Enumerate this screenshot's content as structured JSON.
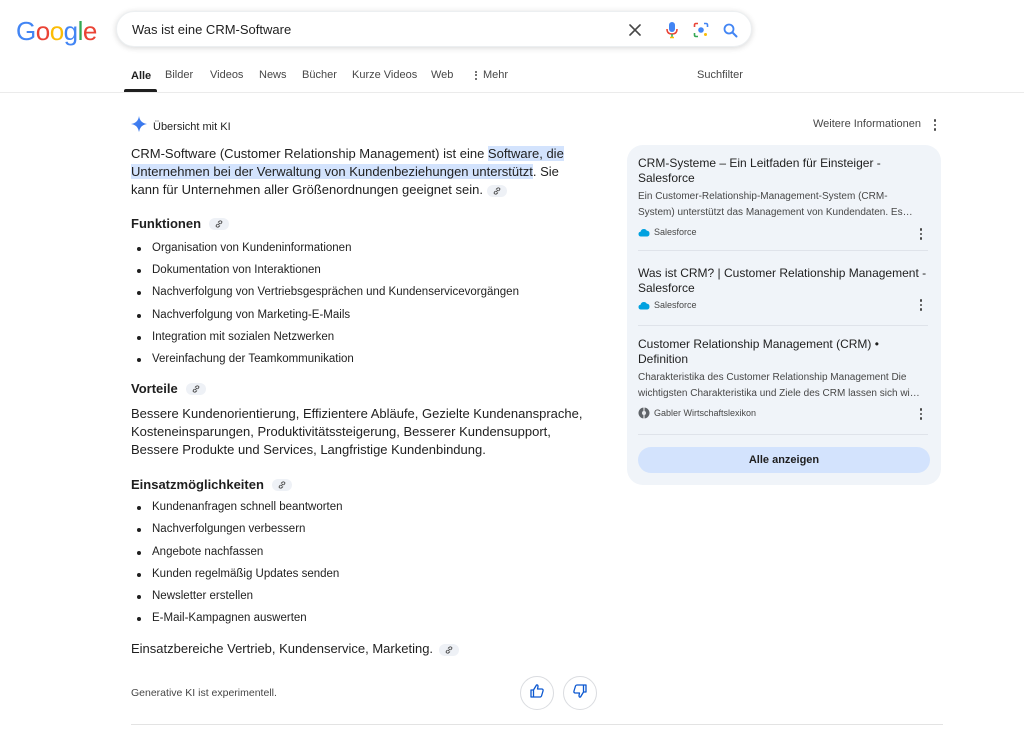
{
  "logo": {
    "letters": [
      "G",
      "o",
      "o",
      "g",
      "l",
      "e"
    ],
    "colors": [
      "#4285F4",
      "#EA4335",
      "#FBBC05",
      "#4285F4",
      "#34A853",
      "#EA4335"
    ]
  },
  "search": {
    "query": "Was ist eine CRM-Software",
    "icons": [
      "close-icon",
      "microphone-icon",
      "lens-icon",
      "search-icon"
    ]
  },
  "tabs": [
    "Alle",
    "Bilder",
    "Videos",
    "News",
    "Bücher",
    "Kurze Videos",
    "Web",
    "Mehr"
  ],
  "tools_label": "Suchfilter",
  "overview": {
    "title": "Übersicht mit KI",
    "more_info": "Weitere Informationen",
    "intro_before": "CRM-Software (Customer Relationship Management) ist eine ",
    "intro_highlight_1": "Software, die",
    "intro_highlight_2": "Unternehmen bei der Verwaltung von Kundenbeziehungen unterstützt",
    "intro_after_1": ". Sie",
    "intro_after_2": "kann für Unternehmen aller Größenordnungen geeignet sein.",
    "functions_heading": "Funktionen",
    "functions": [
      "Organisation von Kundeninformationen",
      "Dokumentation von Interaktionen",
      "Nachverfolgung von Vertriebsgesprächen und Kundenservicevorgängen",
      "Nachverfolgung von Marketing-E-Mails",
      "Integration mit sozialen Netzwerken",
      "Vereinfachung der Teamkommunikation"
    ],
    "benefits_heading": "Vorteile",
    "benefits_line_1": "Bessere Kundenorientierung, Effizientere Abläufe, Gezielte Kundenansprache,",
    "benefits_line_2": "Kosteneinsparungen, Produktivitätssteigerung, Besserer Kundensupport,",
    "benefits_line_3": "Bessere Produkte und Services, Langfristige Kundenbindung.",
    "uses_heading": "Einsatzmöglichkeiten",
    "uses": [
      "Kundenanfragen schnell beantworten",
      "Nachverfolgungen verbessern",
      "Angebote nachfassen",
      "Kunden regelmäßig Updates senden",
      "Newsletter erstellen",
      "E-Mail-Kampagnen auswerten"
    ],
    "areas": "Einsatzbereiche Vertrieb, Kundenservice, Marketing.",
    "footer_note": "Generative KI ist experimentell."
  },
  "sources": [
    {
      "title_1": "CRM-Systeme – Ein Leitfaden für Einsteiger -",
      "title_2": "Salesforce",
      "snippet_1": "Ein Customer-Relationship-Management-System (CRM-",
      "snippet_2": "System) unterstützt das Management von Kundendaten. Es…",
      "site": "Salesforce"
    },
    {
      "title_1": "Was ist CRM? | Customer Relationship Management -",
      "title_2": "Salesforce",
      "site": "Salesforce"
    },
    {
      "title_1": "Customer Relationship Management (CRM) •",
      "title_2": "Definition",
      "snippet_1": "Charakteristika des Customer Relationship Management Die",
      "snippet_2": "wichtigsten Charakteristika und Ziele des CRM lassen sich wi…",
      "site": "Gabler Wirtschaftslexikon"
    }
  ],
  "show_all": "Alle anzeigen",
  "colors": {
    "accent": "#0b57d0",
    "panel": "#f0f4f9",
    "highlight": "#d3e3fd",
    "salesforce": "#00a1e0"
  }
}
